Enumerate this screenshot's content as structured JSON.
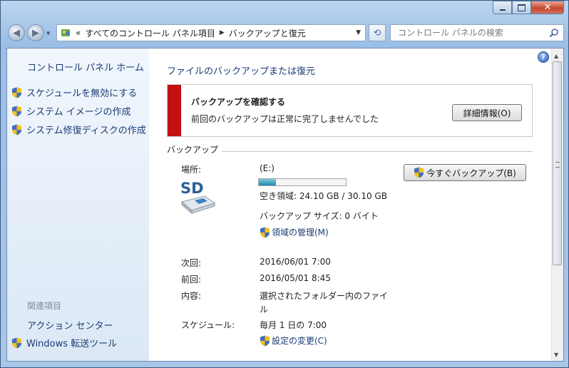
{
  "nav": {
    "breadcrumb_prefix": "«",
    "breadcrumb": [
      "すべてのコントロール パネル項目",
      "バックアップと復元"
    ],
    "search_placeholder": "コントロール パネルの検索"
  },
  "sidebar": {
    "home": "コントロール パネル ホーム",
    "tasks": [
      "スケジュールを無効にする",
      "システム イメージの作成",
      "システム修復ディスクの作成"
    ],
    "related_heading": "関連項目",
    "related": [
      "アクション センター",
      "Windows 転送ツール"
    ]
  },
  "main": {
    "title_link": "ファイルのバックアップまたは復元",
    "warning": {
      "title": "バックアップを確認する",
      "message": "前回のバックアップは正常に完了しませんでした",
      "details_button": "詳細情報(O)"
    },
    "backup": {
      "section_label": "バックアップ",
      "location_label": "場所:",
      "drive": "(E:)",
      "drive_icon_text": "SD",
      "usage_fraction": 0.2,
      "free_space": "空き領域: 24.10 GB / 30.10 GB",
      "backup_size": "バックアップ サイズ: 0 バイト",
      "manage_link": "領域の管理(M)",
      "backup_now_button": "今すぐバックアップ(B)",
      "next_label": "次回:",
      "next_value": "2016/06/01 7:00",
      "last_label": "前回:",
      "last_value": "2016/05/01 8:45",
      "contents_label": "内容:",
      "contents_value": "選択されたフォルダー内のファイル",
      "schedule_label": "スケジュール:",
      "schedule_value": "毎月 1 日の 7:00",
      "change_settings_link": "設定の変更(C)"
    }
  },
  "colors": {
    "error_red": "#c40f13",
    "link_blue": "#1a3c74"
  }
}
